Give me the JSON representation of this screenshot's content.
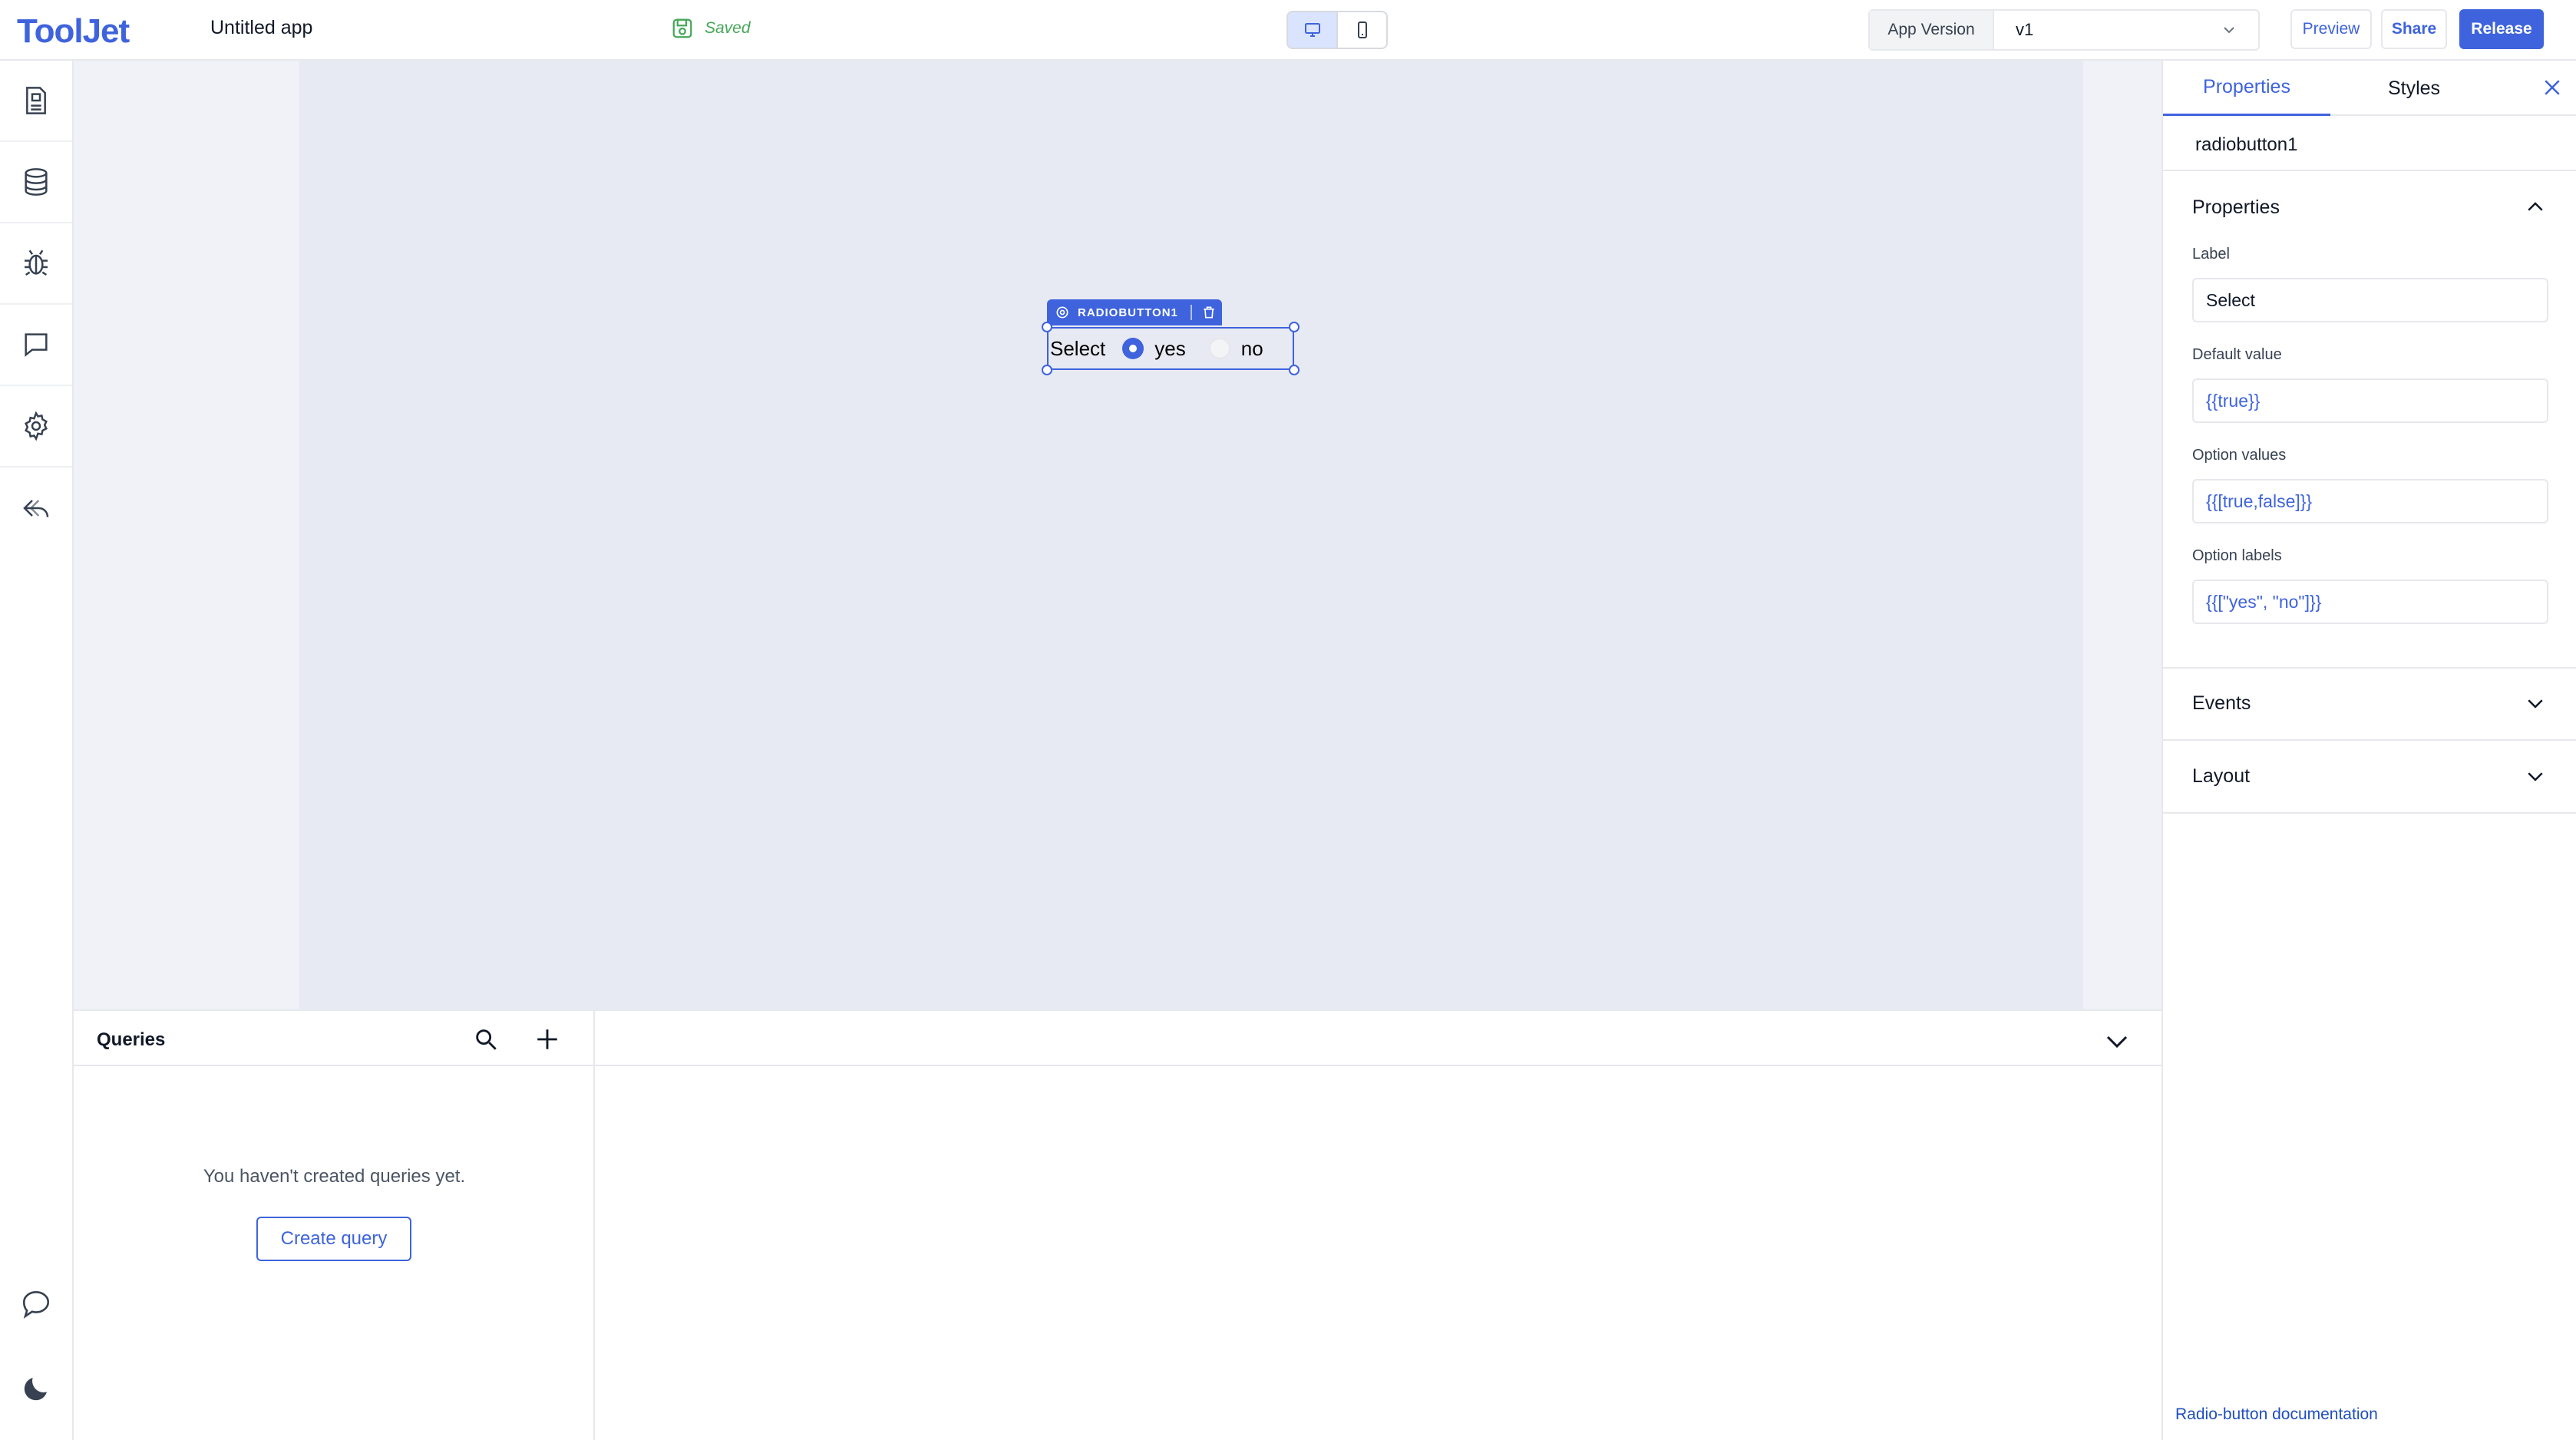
{
  "header": {
    "logo": "ToolJet",
    "app_title": "Untitled app",
    "save_status": "Saved",
    "device_modes": [
      "desktop",
      "mobile"
    ],
    "active_device": "desktop",
    "version_label": "App Version",
    "version_value": "v1",
    "preview_label": "Preview",
    "share_label": "Share",
    "release_label": "Release"
  },
  "sidebar": {
    "items": [
      {
        "icon": "page-icon"
      },
      {
        "icon": "database-icon"
      },
      {
        "icon": "debugger-bug-icon"
      },
      {
        "icon": "comments-icon"
      },
      {
        "icon": "settings-gear-icon"
      },
      {
        "icon": "undo-reply-icon"
      }
    ],
    "bottom": [
      {
        "icon": "chat-bubble-icon"
      },
      {
        "icon": "dark-mode-moon-icon"
      }
    ]
  },
  "canvas": {
    "widget": {
      "tag": "RADIOBUTTON1",
      "label": "Select",
      "options": [
        {
          "label": "yes",
          "selected": true
        },
        {
          "label": "no",
          "selected": false
        }
      ]
    }
  },
  "queries": {
    "title": "Queries",
    "empty_message": "You haven't created queries yet.",
    "create_label": "Create query"
  },
  "inspector": {
    "tabs": [
      {
        "label": "Properties",
        "active": true
      },
      {
        "label": "Styles",
        "active": false
      }
    ],
    "component_name": "radiobutton1",
    "properties_section": "Properties",
    "fields": [
      {
        "label": "Label",
        "value": "Select"
      },
      {
        "label": "Default value",
        "value": "{{true}}"
      },
      {
        "label": "Option values",
        "value": "{{[true,false]}}"
      },
      {
        "label": "Option labels",
        "value": "{{[\"yes\", \"no\"]}}"
      }
    ],
    "events_section": "Events",
    "layout_section": "Layout",
    "doc_link": "Radio-button documentation"
  },
  "colors": {
    "accent": "#3e63dd",
    "saved_green": "#46a758",
    "canvas_bg": "#e7eaf2",
    "border": "#e6e8ec"
  }
}
